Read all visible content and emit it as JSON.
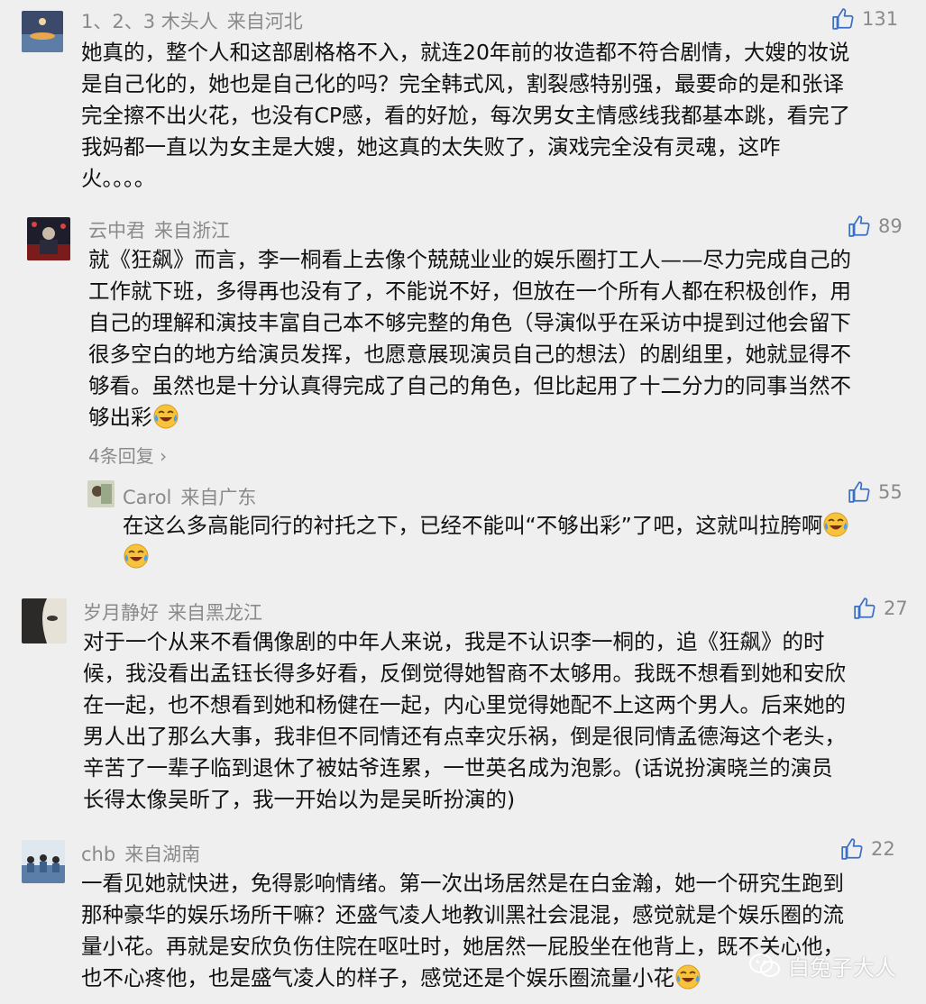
{
  "comments": [
    {
      "user": "1、2、3 木头人",
      "location": "来自河北",
      "likes": "131",
      "lines": [
        "她真的，整个人和这部剧格格不入，就连20年前的妆造都不符合剧情，大嫂的妆说",
        "是自己化的，她也是自己化的吗？完全韩式风，割裂感特别强，最要命的是和张译",
        "完全擦不出火花，也没有CP感，看的好尬，每次男女主情感线我都基本跳，看完了",
        "我妈都一直以为女主是大嫂，她这真的太失败了，演戏完全没有灵魂，这咋",
        "火。。。。"
      ]
    },
    {
      "user": "云中君",
      "location": "来自浙江",
      "likes": "89",
      "lines": [
        "就《狂飙》而言，李一桐看上去像个兢兢业业的娱乐圈打工人——尽力完成自己的",
        "工作就下班，多得再也没有了，不能说不好，但放在一个所有人都在积极创作，用",
        "自己的理解和演技丰富自己本不够完整的角色（导演似乎在采访中提到过他会留下",
        "很多空白的地方给演员发挥，也愿意展现演员自己的想法）的剧组里，她就显得不",
        "够看。虽然也是十分认真得完成了自己的角色，但比起用了十二分力的同事当然不",
        "够出彩"
      ],
      "replies_link": "4条回复",
      "reply": {
        "user": "Carol",
        "location": "来自广东",
        "likes": "55",
        "lines": [
          "在这么多高能同行的衬托之下，已经不能叫“不够出彩”了吧，这就叫拉胯啊"
        ]
      }
    },
    {
      "user": "岁月静好",
      "location": "来自黑龙江",
      "likes": "27",
      "lines": [
        "对于一个从来不看偶像剧的中年人来说，我是不认识李一桐的，追《狂飙》的时",
        "候，我没看出孟钰长得多好看，反倒觉得她智商不太够用。我既不想看到她和安欣",
        "在一起，也不想看到她和杨健在一起，内心里觉得她配不上这两个男人。后来她的",
        "男人出了那么大事，我非但不同情还有点幸灾乐祸，倒是很同情孟德海这个老头，",
        "辛苦了一辈子临到退休了被姑爷连累，一世英名成为泡影。(话说扮演晓兰的演员",
        "长得太像吴昕了，我一开始以为是吴昕扮演的)"
      ]
    },
    {
      "user": "chb",
      "location": "来自湖南",
      "likes": "22",
      "lines": [
        "一看见她就快进，免得影响情绪。第一次出场居然是在白金瀚，她一个研究生跑到",
        "那种豪华的娱乐场所干嘛？还盛气凌人地教训黑社会混混，感觉就是个娱乐圈的流",
        "量小花。再就是安欣负伤住院在呕吐时，她居然一屁股坐在他背上，既不关心他，",
        "也不心疼他，也是盛气凌人的样子，感觉还是个娱乐圈流量小花"
      ]
    }
  ],
  "watermark": "白兔子大人",
  "colors": {
    "background": "#efefef",
    "meta": "#8a8a8a",
    "text": "#111111"
  },
  "icons": {
    "like": "thumbs-up-icon",
    "laugh": "laughing-tears-emoji-icon",
    "watermark": "wechat-icon"
  }
}
